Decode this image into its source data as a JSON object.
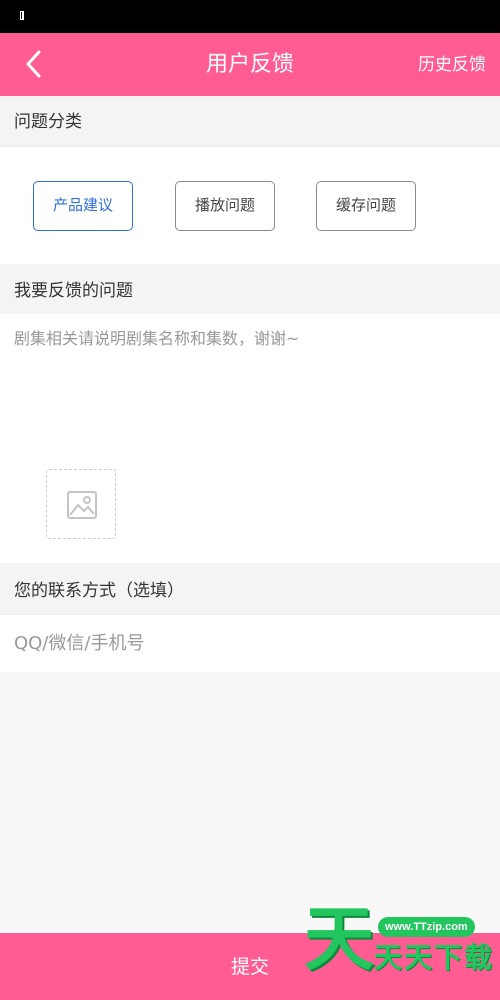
{
  "header": {
    "title": "用户反馈",
    "history_label": "历史反馈",
    "back_icon": "chevron-left-icon"
  },
  "colors": {
    "accent": "#ff5c93",
    "selected": "#2f6fd6",
    "watermark": "#22c55e"
  },
  "category_section": {
    "title": "问题分类",
    "options": [
      {
        "label": "产品建议",
        "selected": true
      },
      {
        "label": "播放问题",
        "selected": false
      },
      {
        "label": "缓存问题",
        "selected": false
      }
    ]
  },
  "feedback_section": {
    "title": "我要反馈的问题",
    "placeholder": "剧集相关请说明剧集名称和集数，谢谢~",
    "image_icon": "image-placeholder-icon"
  },
  "contact_section": {
    "title": "您的联系方式（选填）",
    "placeholder": "QQ/微信/手机号"
  },
  "footer": {
    "submit_label": "提交"
  },
  "watermark": {
    "big_char": "天",
    "url": "www.TTzip.com",
    "text": "天天下载"
  }
}
